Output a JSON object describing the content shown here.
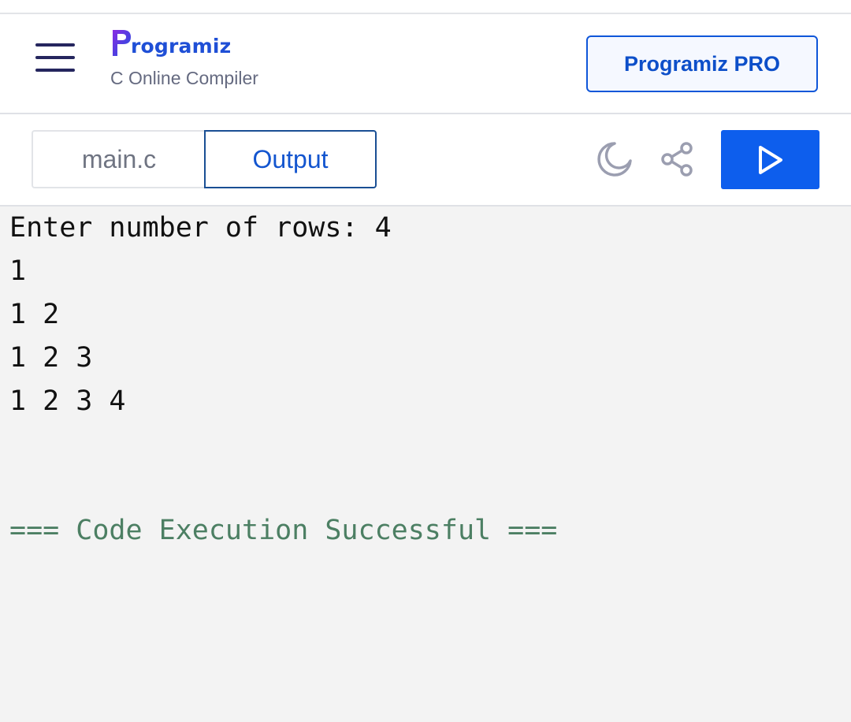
{
  "header": {
    "logo_text": "rogramiz",
    "subtitle": "C Online Compiler",
    "pro_button": "Programiz PRO"
  },
  "toolbar": {
    "tabs": [
      {
        "label": "main.c",
        "active": false
      },
      {
        "label": "Output",
        "active": true
      }
    ],
    "icons": [
      "moon-icon",
      "share-icon",
      "play-icon"
    ],
    "run_color": "#0d5eed"
  },
  "output": {
    "lines": [
      "Enter number of rows: 4",
      "1",
      "1 2",
      "1 2 3",
      "1 2 3 4"
    ],
    "status": "=== Code Execution Successful ==="
  },
  "colors": {
    "brand": "#1f4fd6",
    "accent": "#0d5eed",
    "success_text": "#4c7f63"
  }
}
